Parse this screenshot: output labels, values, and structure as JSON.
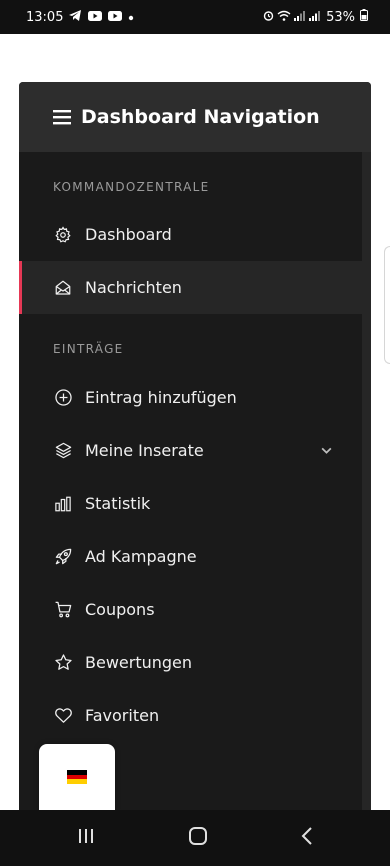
{
  "status_bar": {
    "time": "13:05",
    "battery": "53%",
    "icons": [
      "telegram-icon",
      "youtube-icon",
      "youtube-icon",
      "dot-icon",
      "alarm-icon",
      "wifi-icon",
      "signal-icon",
      "signal-icon",
      "battery-icon"
    ]
  },
  "panel": {
    "title": "Dashboard Navigation",
    "sections": [
      {
        "title": "KOMMANDOZENTRALE",
        "items": [
          {
            "label": "Dashboard",
            "icon": "gear-icon"
          },
          {
            "label": "Nachrichten",
            "icon": "envelope-open-icon",
            "active": true
          }
        ]
      },
      {
        "title": "EINTRÄGE",
        "items": [
          {
            "label": "Eintrag hinzufügen",
            "icon": "plus-circle-icon"
          },
          {
            "label": "Meine Inserate",
            "icon": "layers-icon",
            "has_submenu": true
          },
          {
            "label": "Statistik",
            "icon": "bar-chart-icon"
          },
          {
            "label": "Ad Kampagne",
            "icon": "rocket-icon"
          },
          {
            "label": "Coupons",
            "icon": "cart-icon"
          },
          {
            "label": "Bewertungen",
            "icon": "star-icon"
          },
          {
            "label": "Favoriten",
            "icon": "heart-icon"
          }
        ]
      }
    ]
  },
  "language_switcher": {
    "flag": "de-flag-icon"
  },
  "colors": {
    "panel_bg": "#1a1a1a",
    "header_bg": "#2d2d2d",
    "active_bg": "#262626",
    "accent": "#e53855",
    "flag": [
      "#000000",
      "#dd0000",
      "#ffce00"
    ]
  }
}
